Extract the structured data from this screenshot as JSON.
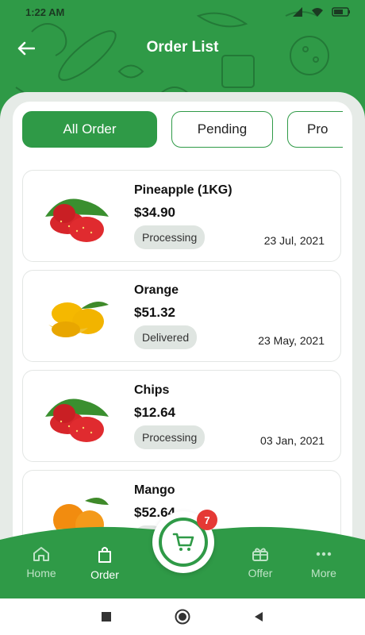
{
  "status": {
    "time": "1:22 AM"
  },
  "appbar": {
    "title": "Order List"
  },
  "tabs": [
    {
      "label": "All Order",
      "active": true
    },
    {
      "label": "Pending",
      "active": false
    },
    {
      "label": "Pro",
      "active": false
    }
  ],
  "orders": [
    {
      "name": "Pineapple (1KG)",
      "price": "$34.90",
      "status": "Processing",
      "date": "23 Jul, 2021",
      "image": "strawberry-image"
    },
    {
      "name": "Orange",
      "price": "$51.32",
      "status": "Delivered",
      "date": "23 May, 2021",
      "image": "mango-image"
    },
    {
      "name": "Chips",
      "price": "$12.64",
      "status": "Processing",
      "date": "03 Jan, 2021",
      "image": "strawberry-image"
    },
    {
      "name": "Mango",
      "price": "$52.64",
      "status": "Pe",
      "date": "",
      "image": "orange-image"
    }
  ],
  "bottom_nav": {
    "items": [
      {
        "label": "Home",
        "icon": "home-icon",
        "active": false
      },
      {
        "label": "Order",
        "icon": "bag-icon",
        "active": true
      },
      {
        "label": "Offer",
        "icon": "gift-icon",
        "active": false
      },
      {
        "label": "More",
        "icon": "more-dots-icon",
        "active": false
      }
    ],
    "cart_count": "7"
  },
  "colors": {
    "primary": "#2f9a47",
    "badge_bg": "#dfe5e1",
    "cart_badge": "#e53935"
  }
}
